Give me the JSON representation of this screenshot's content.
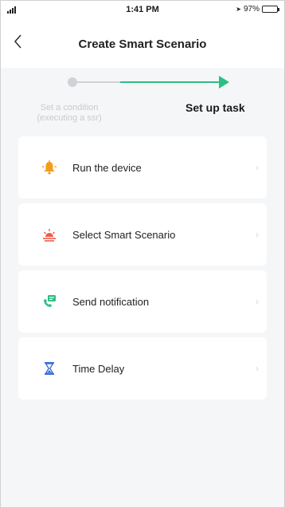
{
  "status_bar": {
    "time": "1:41 PM",
    "battery": "97%"
  },
  "header": {
    "title": "Create Smart Scenario"
  },
  "stepper": {
    "step1_label": "Set a condition (executing a ssr)",
    "step2_label": "Set up task"
  },
  "tasks": [
    {
      "label": "Run the device",
      "icon": "bell-icon",
      "color": "#f39c1f"
    },
    {
      "label": "Select Smart Scenario",
      "icon": "sunrise-icon",
      "color": "#f05a4a"
    },
    {
      "label": "Send notification",
      "icon": "notification-icon",
      "color": "#2bbf84"
    },
    {
      "label": "Time Delay",
      "icon": "hourglass-icon",
      "color": "#3f6fd8"
    }
  ],
  "colors": {
    "accent_green": "#2bbf84",
    "background": "#f5f6f7"
  }
}
